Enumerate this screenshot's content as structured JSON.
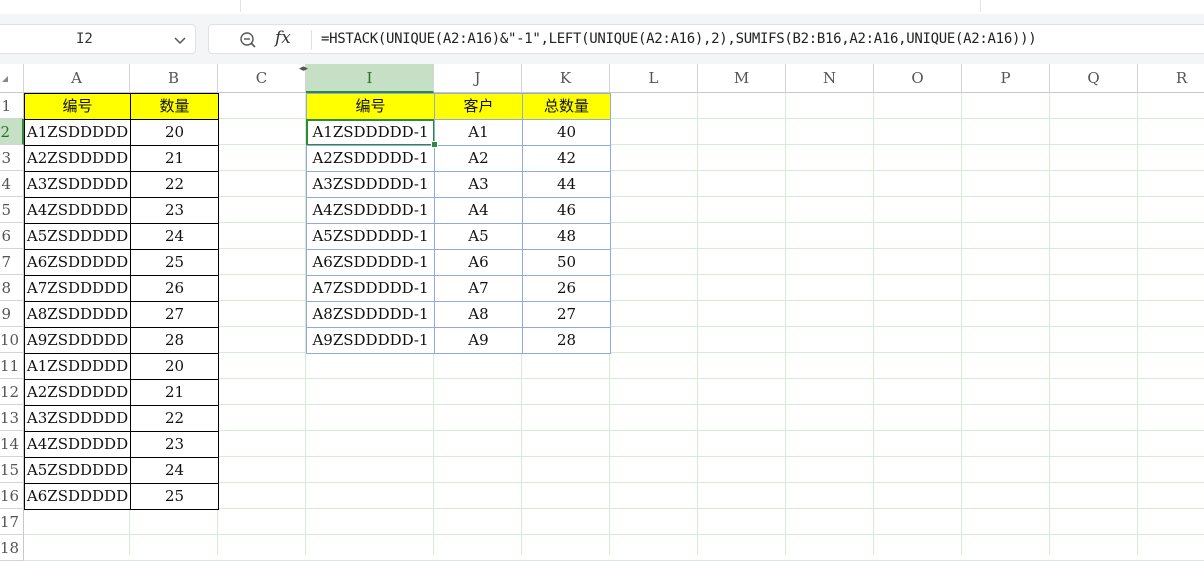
{
  "name_box": {
    "value": "I2"
  },
  "formula_bar": {
    "fx_label": "fx",
    "formula": "=HSTACK(UNIQUE(A2:A16)&\"-1\",LEFT(UNIQUE(A2:A16),2),SUMIFS(B2:B16,A2:A16,UNIQUE(A2:A16)))"
  },
  "columns": [
    "A",
    "B",
    "C",
    "I",
    "J",
    "K",
    "L",
    "M",
    "N",
    "O",
    "P",
    "Q",
    "R"
  ],
  "rows": [
    "1",
    "2",
    "3",
    "4",
    "5",
    "6",
    "7",
    "8",
    "9",
    "10",
    "11",
    "12",
    "13",
    "14",
    "15",
    "16",
    "17",
    "18"
  ],
  "selected_column": "I",
  "selected_row": "2",
  "source_table": {
    "headers": [
      "编号",
      "数量"
    ],
    "rows": [
      [
        "A1ZSDDDDD",
        "20"
      ],
      [
        "A2ZSDDDDD",
        "21"
      ],
      [
        "A3ZSDDDDD",
        "22"
      ],
      [
        "A4ZSDDDDD",
        "23"
      ],
      [
        "A5ZSDDDDD",
        "24"
      ],
      [
        "A6ZSDDDDD",
        "25"
      ],
      [
        "A7ZSDDDDD",
        "26"
      ],
      [
        "A8ZSDDDDD",
        "27"
      ],
      [
        "A9ZSDDDDD",
        "28"
      ],
      [
        "A1ZSDDDDD",
        "20"
      ],
      [
        "A2ZSDDDDD",
        "21"
      ],
      [
        "A3ZSDDDDD",
        "22"
      ],
      [
        "A4ZSDDDDD",
        "23"
      ],
      [
        "A5ZSDDDDD",
        "24"
      ],
      [
        "A6ZSDDDDD",
        "25"
      ]
    ]
  },
  "result_table": {
    "headers": [
      "编号",
      "客户",
      "总数量"
    ],
    "rows": [
      [
        "A1ZSDDDDD-1",
        "A1",
        "40"
      ],
      [
        "A2ZSDDDDD-1",
        "A2",
        "42"
      ],
      [
        "A3ZSDDDDD-1",
        "A3",
        "44"
      ],
      [
        "A4ZSDDDDD-1",
        "A4",
        "46"
      ],
      [
        "A5ZSDDDDD-1",
        "A5",
        "48"
      ],
      [
        "A6ZSDDDDD-1",
        "A6",
        "50"
      ],
      [
        "A7ZSDDDDD-1",
        "A7",
        "26"
      ],
      [
        "A8ZSDDDDD-1",
        "A8",
        "27"
      ],
      [
        "A9ZSDDDDD-1",
        "A9",
        "28"
      ]
    ]
  },
  "colors": {
    "header_fill": "#ffff00",
    "selection": "#2f8a3b",
    "gridline": "#d6ead6"
  }
}
